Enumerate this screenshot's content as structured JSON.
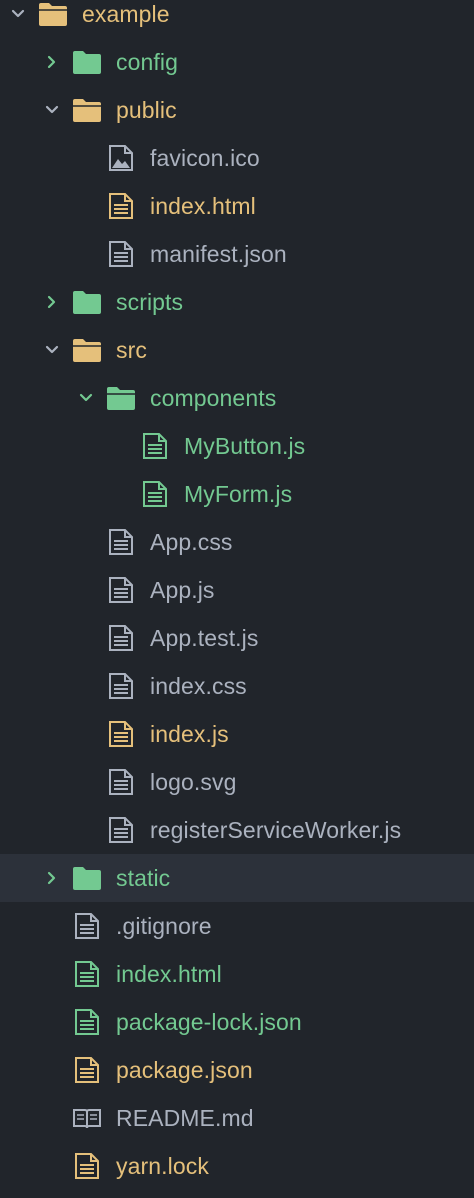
{
  "colors": {
    "background": "#21252b",
    "selected_row": "#2c313a",
    "green": "#73c991",
    "orange": "#e5c07b",
    "gray": "#abb2bf",
    "folder_open": "#e5c07b",
    "folder_closed": "#73c991"
  },
  "tree": {
    "root": {
      "label": "example",
      "state": "expanded"
    },
    "config": {
      "label": "config",
      "state": "collapsed"
    },
    "public": {
      "label": "public",
      "state": "expanded",
      "files": [
        "favicon.ico",
        "index.html",
        "manifest.json"
      ]
    },
    "scripts": {
      "label": "scripts",
      "state": "collapsed"
    },
    "src": {
      "label": "src",
      "state": "expanded",
      "components": {
        "label": "components",
        "state": "expanded",
        "files": [
          "MyButton.js",
          "MyForm.js"
        ]
      },
      "files": [
        "App.css",
        "App.js",
        "App.test.js",
        "index.css",
        "index.js",
        "logo.svg",
        "registerServiceWorker.js"
      ]
    },
    "static": {
      "label": "static",
      "state": "collapsed",
      "selected": true
    },
    "root_files": [
      ".gitignore",
      "index.html",
      "package-lock.json",
      "package.json",
      "README.md",
      "yarn.lock"
    ]
  },
  "icons": {
    "chevron_down": "chevron-down-icon",
    "chevron_right": "chevron-right-icon",
    "folder": "folder-icon",
    "file": "file-text-icon",
    "image": "image-file-icon",
    "book": "book-icon"
  }
}
